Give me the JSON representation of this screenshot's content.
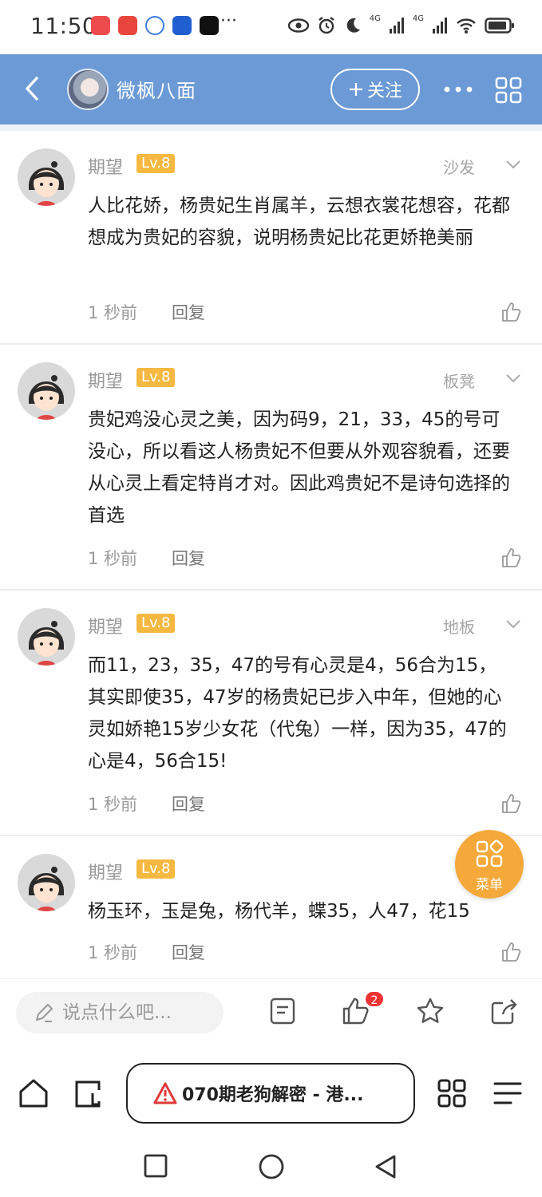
{
  "status_bar": {
    "time": "11:50",
    "more_indicator": "···",
    "network_labels": [
      "4G",
      "4G"
    ],
    "battery_icon": "battery-icon"
  },
  "header": {
    "title": "微枫八面",
    "follow_label": "关注",
    "back_icon": "chevron-left-icon",
    "more_icon": "more-dots-icon",
    "grid_icon": "grid-icon"
  },
  "comments": [
    {
      "name": "期望",
      "level": "Lv.8",
      "floor": "沙发",
      "text": "人比花娇，杨贵妃生肖属羊，云想衣裳花想容，花都想成为贵妃的容貌，说明杨贵妃比花更娇艳美丽",
      "time": "1 秒前",
      "reply": "回复"
    },
    {
      "name": "期望",
      "level": "Lv.8",
      "floor": "板凳",
      "text": "贵妃鸡没心灵之美，因为码9，21，33，45的号可没心，所以看这人杨贵妃不但要从外观容貌看，还要从心灵上看定特肖才对。因此鸡贵妃不是诗句选择的首选",
      "time": "1 秒前",
      "reply": "回复"
    },
    {
      "name": "期望",
      "level": "Lv.8",
      "floor": "地板",
      "text": "而11，23，35，47的号有心灵是4，56合为15，其实即使35，47岁的杨贵妃已步入中年，但她的心灵如娇艳15岁少女花（代兔）一样，因为35，47的心是4，56合15!",
      "time": "1 秒前",
      "reply": "回复"
    },
    {
      "name": "期望",
      "level": "Lv.8",
      "floor": "",
      "text": "杨玉环，玉是兔，杨代羊，蝶35，人47，花15",
      "time": "1 秒前",
      "reply": "回复"
    }
  ],
  "float_menu": {
    "label": "菜单"
  },
  "action_bar": {
    "input_placeholder": "说点什么吧...",
    "like_badge": "2"
  },
  "browser_bar": {
    "url_text": "070期老狗解密 - 港..."
  },
  "colors": {
    "header_bg": "#6b9ad6",
    "level_badge": "#f5b841",
    "float_menu": "#f5a93a",
    "badge_red": "#e33333"
  }
}
